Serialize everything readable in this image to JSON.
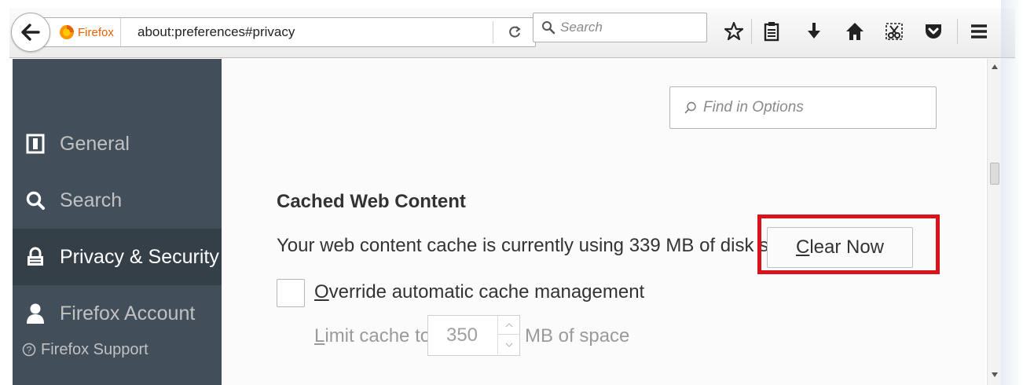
{
  "toolbar": {
    "identity_label": "Firefox",
    "url": "about:preferences#privacy",
    "search_placeholder": "Search"
  },
  "sidebar": {
    "items": [
      {
        "label": "General",
        "icon": "general-icon",
        "selected": false
      },
      {
        "label": "Search",
        "icon": "search-magnifier-icon",
        "selected": false
      },
      {
        "label": "Privacy & Security",
        "icon": "lock-icon",
        "selected": true
      },
      {
        "label": "Firefox Account",
        "icon": "person-icon",
        "selected": false
      }
    ],
    "support_label": "Firefox Support"
  },
  "main": {
    "find_placeholder": "Find in Options",
    "section_title": "Cached Web Content",
    "cache_status": "Your web content cache is currently using 339 MB of disk space",
    "clear_now_access_key": "C",
    "clear_now_rest": "lear Now",
    "override_access_key": "O",
    "override_rest": "verride automatic cache management",
    "override_checked": false,
    "limit_access_key": "L",
    "limit_rest": "imit cache to",
    "limit_value": "350",
    "limit_unit": "MB of space"
  },
  "colors": {
    "sidebar_bg": "#424f5a",
    "sidebar_selected_bg": "#343f48",
    "highlight": "#d9131c",
    "firefox_orange": "#e66000"
  }
}
